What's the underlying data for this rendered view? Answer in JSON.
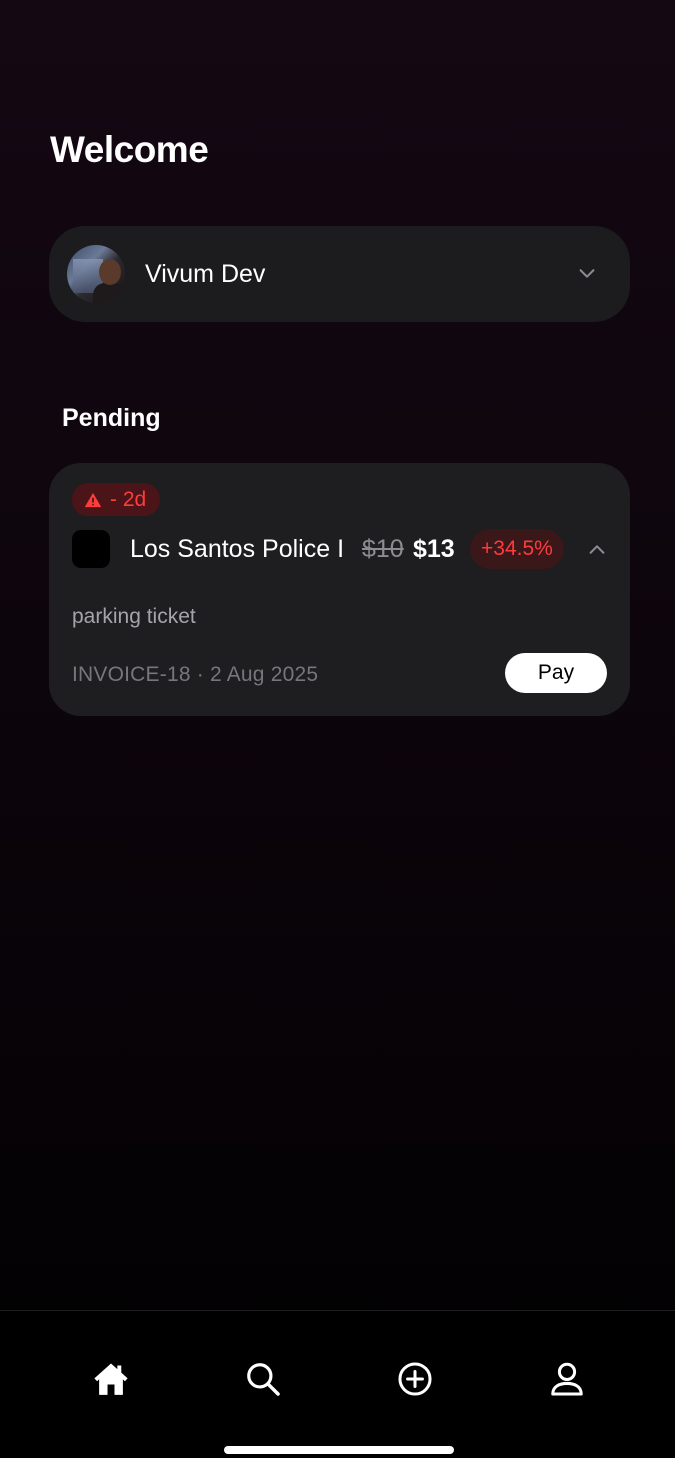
{
  "header": {
    "title": "Welcome"
  },
  "account": {
    "name": "Vivum Dev",
    "avatar_icon": "profile-photo",
    "chevron_icon": "chevron-down-icon"
  },
  "pending": {
    "title": "Pending",
    "invoices": [
      {
        "due_label": "- 2d",
        "due_icon": "warning-triangle-icon",
        "merchant": "Los Santos Police I",
        "original_price": "$10",
        "price": "$13",
        "change": "+34.5%",
        "description": "parking ticket",
        "meta": "INVOICE-18 · 2 Aug 2025",
        "pay_label": "Pay"
      }
    ]
  },
  "tabbar": {
    "items": [
      {
        "name": "home",
        "icon": "home-icon",
        "active": true
      },
      {
        "name": "search",
        "icon": "search-icon",
        "active": false
      },
      {
        "name": "create",
        "icon": "plus-circle-icon",
        "active": false
      },
      {
        "name": "profile",
        "icon": "person-icon",
        "active": false
      }
    ]
  },
  "colors": {
    "background_top": "#140813",
    "card": "#1e1d20",
    "alert_red": "#ff3b3b",
    "alert_bg": "#4a1418",
    "button_bg": "#ffffff"
  }
}
